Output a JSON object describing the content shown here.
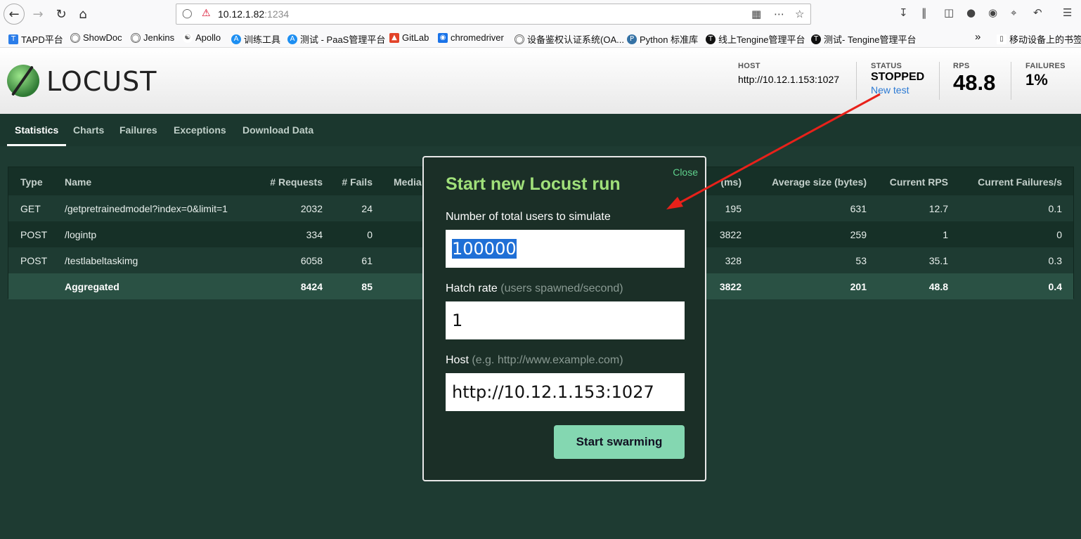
{
  "browser": {
    "url_host": "10.12.1.82",
    "url_port": ":1234",
    "back_icon": "back-arrow-icon",
    "forward_icon": "forward-arrow-icon",
    "reload_icon": "reload-icon",
    "home_icon": "home-icon"
  },
  "bookmarks": [
    {
      "label": "TAPD平台",
      "icon": "tapd-icon",
      "color": "#2b7de9"
    },
    {
      "label": "ShowDoc",
      "icon": "globe-icon",
      "color": "#666666"
    },
    {
      "label": "Jenkins",
      "icon": "globe-icon",
      "color": "#666666"
    },
    {
      "label": "Apollo",
      "icon": "apollo-icon",
      "color": "#555555"
    },
    {
      "label": "训练工具",
      "icon": "ai-icon",
      "color": "#1d8ff2"
    },
    {
      "label": "测试 - PaaS管理平台",
      "icon": "ai-icon",
      "color": "#1d8ff2"
    },
    {
      "label": "GitLab",
      "icon": "gitlab-icon",
      "color": "#e24329"
    },
    {
      "label": "chromedriver",
      "icon": "chromium-icon",
      "color": "#1a73e8"
    },
    {
      "label": "设备鉴权认证系统(OA...",
      "icon": "globe-icon",
      "color": "#666666"
    },
    {
      "label": "Python 标准库",
      "icon": "python-icon",
      "color": "#3572a5"
    },
    {
      "label": "线上Tengine管理平台",
      "icon": "tengine-icon",
      "color": "#111111"
    },
    {
      "label": "测试- Tengine管理平台",
      "icon": "tengine-icon",
      "color": "#111111"
    }
  ],
  "bookmarks_more": "»",
  "mobile_bookmarks": "移动设备上的书签",
  "header": {
    "logo_text": "LOCUST",
    "host_label": "HOST",
    "host_value": "http://10.12.1.153:1027",
    "status_label": "STATUS",
    "status_value": "STOPPED",
    "new_test_link": "New test",
    "rps_label": "RPS",
    "rps_value": "48.8",
    "failures_label": "FAILURES",
    "failures_value": "1%"
  },
  "tabs": [
    {
      "label": "Statistics",
      "active": true
    },
    {
      "label": "Charts",
      "active": false
    },
    {
      "label": "Failures",
      "active": false
    },
    {
      "label": "Exceptions",
      "active": false
    },
    {
      "label": "Download Data",
      "active": false
    }
  ],
  "stats": {
    "columns": [
      "Type",
      "Name",
      "# Requests",
      "# Fails",
      "Media",
      "(ms)",
      "Average size (bytes)",
      "Current RPS",
      "Current Failures/s"
    ],
    "rows": [
      {
        "type": "GET",
        "name": "/getpretrainedmodel?index=0&limit=1",
        "requests": "2032",
        "fails": "24",
        "max": "195",
        "avg_size": "631",
        "rps": "12.7",
        "fails_s": "0.1"
      },
      {
        "type": "POST",
        "name": "/logintp",
        "requests": "334",
        "fails": "0",
        "max": "3822",
        "avg_size": "259",
        "rps": "1",
        "fails_s": "0"
      },
      {
        "type": "POST",
        "name": "/testlabeltaskimg",
        "requests": "6058",
        "fails": "61",
        "max": "328",
        "avg_size": "53",
        "rps": "35.1",
        "fails_s": "0.3"
      }
    ],
    "aggregated": {
      "type": "",
      "name": "Aggregated",
      "requests": "8424",
      "fails": "85",
      "max": "3822",
      "avg_size": "201",
      "rps": "48.8",
      "fails_s": "0.4"
    }
  },
  "modal": {
    "close": "Close",
    "title": "Start new Locust run",
    "users_label": "Number of total users to simulate",
    "users_value": "100000",
    "hatch_label": "Hatch rate",
    "hatch_hint": "(users spawned/second)",
    "hatch_value": "1",
    "host_label": "Host",
    "host_hint": "(e.g. http://www.example.com)",
    "host_value": "http://10.12.1.153:1027",
    "start_button": "Start swarming"
  },
  "colors": {
    "page_bg": "#1e3b32",
    "modal_title": "#a0e07a",
    "start_button": "#84d7b1",
    "annotation_arrow": "#e8211a"
  }
}
